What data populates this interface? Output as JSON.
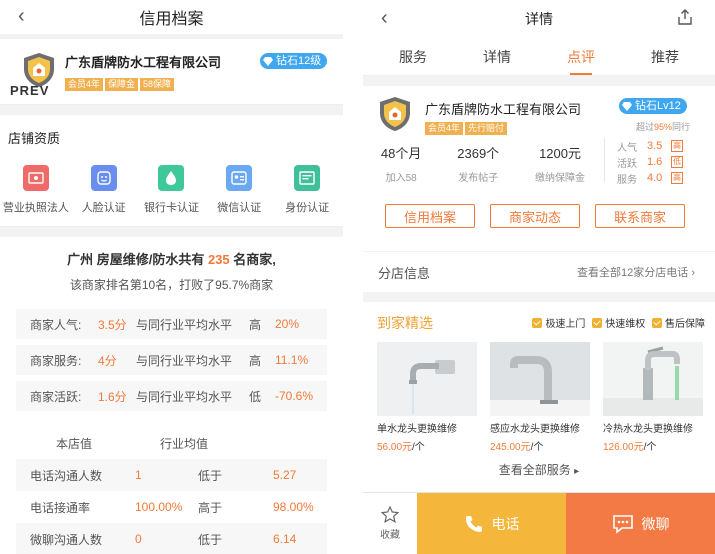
{
  "left": {
    "title": "信用档案",
    "company": {
      "name": "广东盾牌防水工程有限公司",
      "tags": [
        "会员4年",
        "保障金",
        "58保障"
      ],
      "level": "钻石12级",
      "overlay_label": "PREV"
    },
    "qualification": {
      "title": "店铺资质",
      "items": [
        {
          "label": "营业执照法人",
          "icon": "license-icon",
          "color": "#f06a6a"
        },
        {
          "label": "人脸认证",
          "icon": "face-icon",
          "color": "#6a8ef0"
        },
        {
          "label": "银行卡认证",
          "icon": "bank-card-icon",
          "color": "#3fc89a"
        },
        {
          "label": "微信认证",
          "icon": "wechat-icon",
          "color": "#6aa8f0"
        },
        {
          "label": "身份认证",
          "icon": "id-card-icon",
          "color": "#3fbf9a"
        }
      ]
    },
    "rank": {
      "prefix": "广州 房屋维修/防水共有 ",
      "count": "235",
      "suffix": " 名商家,",
      "line2": "该商家排名第10名，打败了95.7%商家"
    },
    "metrics": [
      {
        "label": "商家人气:",
        "score": "3.5分",
        "compare": "与同行业平均水平",
        "level": "高",
        "percent": "20%"
      },
      {
        "label": "商家服务:",
        "score": "4分",
        "compare": "与同行业平均水平",
        "level": "高",
        "percent": "11.1%"
      },
      {
        "label": "商家活跃:",
        "score": "1.6分",
        "compare": "与同行业平均水平",
        "level": "低",
        "percent": "-70.6%"
      }
    ],
    "table": {
      "headers": [
        "本店值",
        "行业均值"
      ],
      "rows": [
        {
          "name": "电话沟通人数",
          "value": "1",
          "cmp": "低于",
          "avg": "5.27"
        },
        {
          "name": "电话接通率",
          "value": "100.00%",
          "cmp": "高于",
          "avg": "98.00%"
        },
        {
          "name": "微聊沟通人数",
          "value": "0",
          "cmp": "低于",
          "avg": "6.14"
        }
      ]
    }
  },
  "right": {
    "title": "详情",
    "tabs": [
      "服务",
      "详情",
      "点评",
      "推荐"
    ],
    "active_tab": 2,
    "company": {
      "name": "广东盾牌防水工程有限公司",
      "tags": [
        "会员4年",
        "先行赔付"
      ],
      "level": "钻石Lv12",
      "exceed_prefix": "超过",
      "exceed_value": "95%",
      "exceed_suffix": "同行"
    },
    "stats": [
      {
        "value": "48个月",
        "label": "加入58"
      },
      {
        "value": "2369个",
        "label": "发布帖子"
      },
      {
        "value": "1200元",
        "label": "缴纳保障金"
      }
    ],
    "popularity": [
      {
        "label": "人气",
        "value": "3.5",
        "badge": "高"
      },
      {
        "label": "活跃",
        "value": "1.6",
        "badge": "低"
      },
      {
        "label": "服务",
        "value": "4.0",
        "badge": "高"
      }
    ],
    "buttons": [
      "信用档案",
      "商家动态",
      "联系商家"
    ],
    "branch": {
      "label": "分店信息",
      "link": "查看全部12家分店电话"
    },
    "featured": {
      "title": "到家精选",
      "guarantees": [
        "极速上门",
        "快速维权",
        "售后保障"
      ],
      "products": [
        {
          "name": "单水龙头更换维修",
          "price": "56.00元",
          "unit": "/个"
        },
        {
          "name": "感应水龙头更换维修",
          "price": "245.00元",
          "unit": "/个"
        },
        {
          "name": "冷热水龙头更换维修",
          "price": "126.00元",
          "unit": "/个"
        }
      ],
      "more": "查看全部服务"
    },
    "bottom": {
      "favorite": "收藏",
      "phone": "电话",
      "chat": "微聊"
    },
    "colors": {
      "accent": "#f07a3a",
      "phone_bg": "#f5b63c",
      "chat_bg": "#f47a45",
      "diamond": "#3fa6f0"
    }
  }
}
